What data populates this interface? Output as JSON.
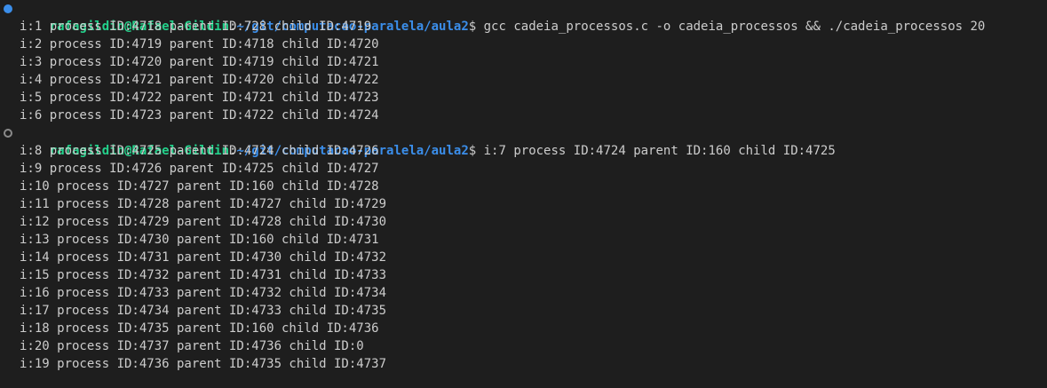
{
  "prompt": {
    "user_host": "rafagildin@Rafael-Gildin",
    "separator": ":",
    "path": "~/git/computacao-paralela/aula2",
    "symbol": "$"
  },
  "command_1": "gcc cadeia_processos.c -o cadeia_processos && ./cadeia_processos 20",
  "output_block_1": [
    "i:1 process ID:4718 parent ID:728 child ID:4719",
    "i:2 process ID:4719 parent ID:4718 child ID:4720",
    "i:3 process ID:4720 parent ID:4719 child ID:4721",
    "i:4 process ID:4721 parent ID:4720 child ID:4722",
    "i:5 process ID:4722 parent ID:4721 child ID:4723",
    "i:6 process ID:4723 parent ID:4722 child ID:4724"
  ],
  "prompt_2_trailing": "i:7 process ID:4724 parent ID:160 child ID:4725",
  "output_block_2": [
    "i:8 process ID:4725 parent ID:4724 child ID:4726",
    "i:9 process ID:4726 parent ID:4725 child ID:4727",
    "i:10 process ID:4727 parent ID:160 child ID:4728",
    "i:11 process ID:4728 parent ID:4727 child ID:4729",
    "i:12 process ID:4729 parent ID:4728 child ID:4730",
    "i:13 process ID:4730 parent ID:160 child ID:4731",
    "i:14 process ID:4731 parent ID:4730 child ID:4732",
    "i:15 process ID:4732 parent ID:4731 child ID:4733",
    "i:16 process ID:4733 parent ID:4732 child ID:4734",
    "i:17 process ID:4734 parent ID:4733 child ID:4735",
    "i:18 process ID:4735 parent ID:160 child ID:4736",
    "i:20 process ID:4737 parent ID:4736 child ID:0",
    "i:19 process ID:4736 parent ID:4735 child ID:4737"
  ],
  "colors": {
    "background": "#1e1e1e",
    "text": "#cccccc",
    "user_host": "#23d18b",
    "path": "#3b8eea",
    "marker_success": "#3b8eea",
    "marker_hollow": "#8a8a8a"
  }
}
